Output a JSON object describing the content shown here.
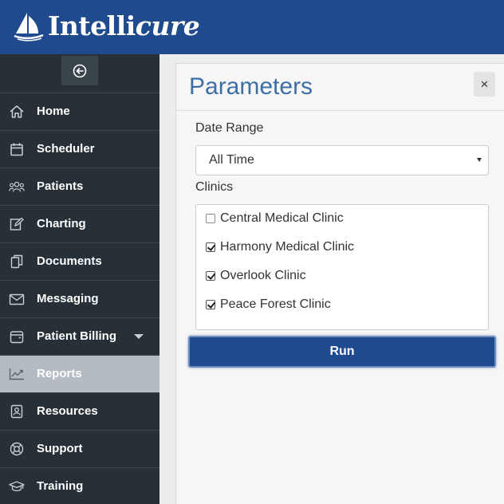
{
  "app": {
    "brand_main": "Intelli",
    "brand_accent": "cure",
    "brand_color": "#1f4b8e"
  },
  "sidebar": {
    "items": [
      {
        "label": "Home",
        "icon": "home-icon"
      },
      {
        "label": "Scheduler",
        "icon": "calendar-icon"
      },
      {
        "label": "Patients",
        "icon": "people-icon"
      },
      {
        "label": "Charting",
        "icon": "edit-icon"
      },
      {
        "label": "Documents",
        "icon": "documents-icon"
      },
      {
        "label": "Messaging",
        "icon": "envelope-icon"
      },
      {
        "label": "Patient Billing",
        "icon": "wallet-icon",
        "has_submenu": true
      },
      {
        "label": "Reports",
        "icon": "chart-icon",
        "active": true
      },
      {
        "label": "Resources",
        "icon": "contact-book-icon"
      },
      {
        "label": "Support",
        "icon": "lifebuoy-icon"
      },
      {
        "label": "Training",
        "icon": "graduation-cap-icon"
      }
    ]
  },
  "panel": {
    "title": "Parameters",
    "close_label": "×",
    "date_range": {
      "label": "Date Range",
      "value": "All Time"
    },
    "clinics": {
      "label": "Clinics",
      "items": [
        {
          "label": "Central Medical Clinic",
          "checked": false
        },
        {
          "label": "Harmony Medical Clinic",
          "checked": true
        },
        {
          "label": "Overlook Clinic",
          "checked": true
        },
        {
          "label": "Peace Forest Clinic",
          "checked": true
        }
      ]
    },
    "run_label": "Run"
  }
}
